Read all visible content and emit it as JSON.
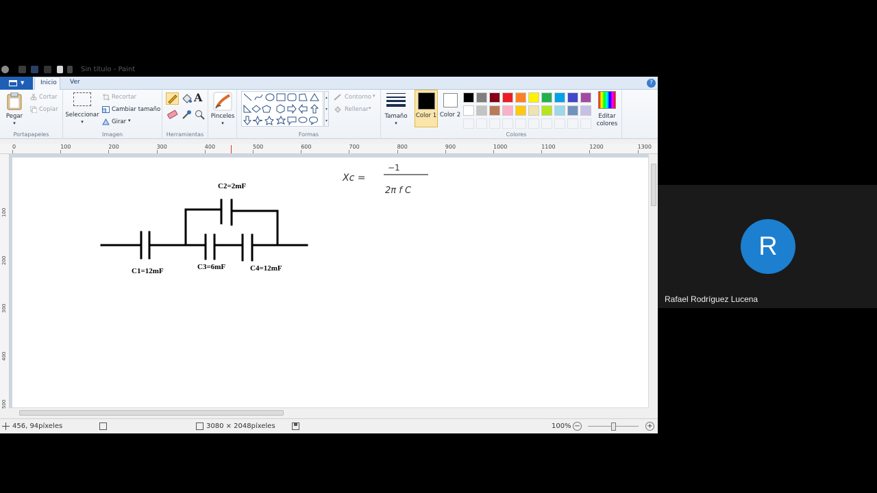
{
  "window": {
    "title": "Sin título - Paint"
  },
  "tabs": [
    {
      "label": "Inicio",
      "active": true
    },
    {
      "label": "Ver",
      "active": false
    }
  ],
  "ribbon": {
    "clipboard": {
      "paste": "Pegar",
      "cut": "Cortar",
      "copy": "Copiar",
      "group": "Portapapeles"
    },
    "image": {
      "select": "Seleccionar",
      "crop": "Recortar",
      "resize": "Cambiar tamaño",
      "rotate": "Girar",
      "group": "Imagen"
    },
    "tools": {
      "group": "Herramientas"
    },
    "brushes": {
      "label": "Pinceles"
    },
    "shapes": {
      "outline": "Contorno",
      "fill": "Rellenar",
      "group": "Formas"
    },
    "size": {
      "label": "Tamaño"
    },
    "colors": {
      "color1": "Color 1",
      "color2": "Color 2",
      "edit": "Editar colores",
      "group": "Colores",
      "color1_value": "#000000",
      "color2_value": "#ffffff",
      "palette_row1": [
        "#000000",
        "#7f7f7f",
        "#880015",
        "#ed1c24",
        "#ff7f27",
        "#fff200",
        "#22b14c",
        "#00a2e8",
        "#3f48cc",
        "#a349a4"
      ],
      "palette_row2": [
        "#ffffff",
        "#c3c3c3",
        "#b97a57",
        "#ffaec9",
        "#ffc90e",
        "#efe4b0",
        "#b5e61d",
        "#99d9ea",
        "#7092be",
        "#c8bfe7"
      ]
    }
  },
  "ruler": {
    "h_labels": [
      "0",
      "100",
      "200",
      "300",
      "400",
      "500",
      "600",
      "700",
      "800",
      "900",
      "1000",
      "1100",
      "1200",
      "1300"
    ],
    "v_labels": [
      "100",
      "200",
      "300",
      "400",
      "500"
    ]
  },
  "drawing": {
    "c1": "C1=12mF",
    "c2": "C2=2mF",
    "c3": "C3=6mF",
    "c4": "C4=12mF",
    "formula_lhs": "Xc =",
    "formula_num": "−1",
    "formula_den": "2π f C"
  },
  "status": {
    "cursor": "456, 94píxeles",
    "dimensions": "3080 × 2048píxeles",
    "zoom": "100%"
  },
  "participant": {
    "initial": "R",
    "name": "Rafael Rodríguez Lucena",
    "avatar_color": "#1c7fd0"
  }
}
